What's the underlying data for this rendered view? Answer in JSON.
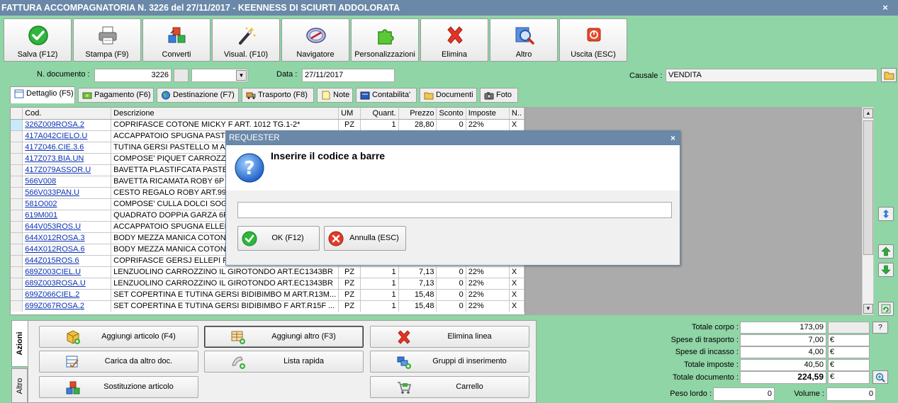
{
  "window": {
    "title": "FATTURA ACCOMPAGNATORIA N. 3226 del 27/11/2017 - KEENNESS DI SCIURTI ADDOLORATA",
    "close": "×"
  },
  "toolbar": [
    {
      "label": "Salva (F12)",
      "icon": "check-icon"
    },
    {
      "label": "Stampa (F9)",
      "icon": "printer-icon"
    },
    {
      "label": "Converti",
      "icon": "convert-icon"
    },
    {
      "label": "Visual. (F10)",
      "icon": "magic-wand-icon"
    },
    {
      "label": "Navigatore",
      "icon": "compass-icon"
    },
    {
      "label": "Personalizzazioni",
      "icon": "puzzle-icon"
    },
    {
      "label": "Elimina",
      "icon": "delete-x-icon"
    },
    {
      "label": "Altro",
      "icon": "magnifier-icon"
    },
    {
      "label": "Uscita (ESC)",
      "icon": "power-icon"
    }
  ],
  "header": {
    "doc_label": "N. documento :",
    "doc_value": "3226",
    "data_label": "Data :",
    "data_value": "27/11/2017",
    "causale_label": "Causale :",
    "causale_value": "VENDITA"
  },
  "tabs": [
    {
      "label": "Dettaglio (F5)"
    },
    {
      "label": "Pagamento (F6)"
    },
    {
      "label": "Destinazione (F7)"
    },
    {
      "label": "Trasporto (F8)"
    },
    {
      "label": "Note"
    },
    {
      "label": "Contabilita'"
    },
    {
      "label": "Documenti"
    },
    {
      "label": "Foto"
    }
  ],
  "grid": {
    "columns": [
      "Cod.",
      "Descrizione",
      "UM",
      "Quant.",
      "Prezzo",
      "Sconto",
      "Imposte",
      "N.."
    ],
    "rows": [
      {
        "cod": "326Z009ROSA.2",
        "desc": "COPRIFASCE  COTONE MICKY F  ART. 1012  TG.1-2*",
        "um": "PZ",
        "quant": "1",
        "prezzo": "28,80",
        "sconto": "0",
        "imposte": "22%",
        "n": "X"
      },
      {
        "cod": "417A042CIELO.U",
        "desc": "ACCAPPATOIO SPUGNA PASTE",
        "um": "",
        "quant": "",
        "prezzo": "",
        "sconto": "",
        "imposte": "",
        "n": ""
      },
      {
        "cod": "417Z046.CIE.3.6",
        "desc": "TUTINA GERSI PASTELLO M AR",
        "um": "",
        "quant": "",
        "prezzo": "",
        "sconto": "",
        "imposte": "",
        "n": ""
      },
      {
        "cod": "417Z073.BIA.UN",
        "desc": "COMPOSE' PIQUET CARROZZIN",
        "um": "",
        "quant": "",
        "prezzo": "",
        "sconto": "",
        "imposte": "",
        "n": ""
      },
      {
        "cod": "417Z079ASSOR.U",
        "desc": "BAVETTA PLASTIFCATA PASTE",
        "um": "",
        "quant": "",
        "prezzo": "",
        "sconto": "",
        "imposte": "",
        "n": ""
      },
      {
        "cod": "566V008",
        "desc": "BAVETTA RICAMATA ROBY  6P",
        "um": "",
        "quant": "",
        "prezzo": "",
        "sconto": "",
        "imposte": "",
        "n": ""
      },
      {
        "cod": "566V033PAN.U",
        "desc": "CESTO REGALO ROBY ART.993",
        "um": "",
        "quant": "",
        "prezzo": "",
        "sconto": "",
        "imposte": "",
        "n": ""
      },
      {
        "cod": "581O002",
        "desc": "COMPOSE' CULLA DOLCI SOGN",
        "um": "",
        "quant": "",
        "prezzo": "",
        "sconto": "",
        "imposte": "",
        "n": ""
      },
      {
        "cod": "619M001",
        "desc": "QUADRATO DOPPIA GARZA 6P",
        "um": "",
        "quant": "",
        "prezzo": "",
        "sconto": "",
        "imposte": "",
        "n": ""
      },
      {
        "cod": "644V053ROS.U",
        "desc": "ACCAPPATOIO SPUGNA ELLEPI",
        "um": "",
        "quant": "",
        "prezzo": "",
        "sconto": "",
        "imposte": "",
        "n": ""
      },
      {
        "cod": "644X012ROSA.3",
        "desc": "BODY MEZZA MANICA  COTON",
        "um": "",
        "quant": "",
        "prezzo": "",
        "sconto": "",
        "imposte": "",
        "n": ""
      },
      {
        "cod": "644X012ROSA.6",
        "desc": "BODY MEZZA MANICA  COTON",
        "um": "",
        "quant": "",
        "prezzo": "",
        "sconto": "",
        "imposte": "",
        "n": ""
      },
      {
        "cod": "644Z015ROS.6",
        "desc": "COPRIFASCE GERSJ  ELLEPI F",
        "um": "",
        "quant": "",
        "prezzo": "",
        "sconto": "",
        "imposte": "",
        "n": ""
      },
      {
        "cod": "689Z003CIEL.U",
        "desc": "LENZUOLINO CARROZZINO IL GIROTONDO ART.EC1343BR",
        "um": "PZ",
        "quant": "1",
        "prezzo": "7,13",
        "sconto": "0",
        "imposte": "22%",
        "n": "X"
      },
      {
        "cod": "689Z003ROSA.U",
        "desc": "LENZUOLINO CARROZZINO IL GIROTONDO ART.EC1343BR",
        "um": "PZ",
        "quant": "1",
        "prezzo": "7,13",
        "sconto": "0",
        "imposte": "22%",
        "n": "X"
      },
      {
        "cod": "699Z066CIEL.2",
        "desc": "SET COPERTINA E TUTINA GERSI BIDIBIMBO M ART.R13M...",
        "um": "PZ",
        "quant": "1",
        "prezzo": "15,48",
        "sconto": "0",
        "imposte": "22%",
        "n": "X"
      },
      {
        "cod": "699Z067ROSA.2",
        "desc": "SET COPERTINA E TUTINA GERSI BIDIBIMBO F ART.R15F ...",
        "um": "PZ",
        "quant": "1",
        "prezzo": "15,48",
        "sconto": "0",
        "imposte": "22%",
        "n": "X"
      }
    ]
  },
  "side_tabs": {
    "azioni": "Azioni",
    "altro": "Altro"
  },
  "actions": [
    {
      "label": "Aggiungi articolo (F4)",
      "icon": "box-add-icon"
    },
    {
      "label": "Aggiungi altro (F3)",
      "icon": "grid-add-icon"
    },
    {
      "label": "Elimina linea",
      "icon": "delete-x-icon"
    },
    {
      "label": "Carica da altro doc.",
      "icon": "load-doc-icon"
    },
    {
      "label": "Lista rapida",
      "icon": "quick-list-icon"
    },
    {
      "label": "Gruppi di inserimento",
      "icon": "group-insert-icon"
    },
    {
      "label": "Sostituzione articolo",
      "icon": "replace-icon"
    },
    {
      "label": "Carrello",
      "icon": "cart-icon"
    }
  ],
  "totals": {
    "corpo_label": "Totale corpo :",
    "corpo": "173,09",
    "trasporto_label": "Spese di trasporto :",
    "trasporto": "7,00",
    "incasso_label": "Spese di incasso :",
    "incasso": "4,00",
    "imposte_label": "Totale imposte :",
    "imposte": "40,50",
    "documento_label": "Totale documento :",
    "documento": "224,59",
    "currency": "€",
    "peso_label": "Peso lordo :",
    "peso": "0",
    "volume_label": "Volume :",
    "volume": "0",
    "help": "?"
  },
  "dialog": {
    "title": "REQUESTER",
    "close": "×",
    "message": "Inserire il codice a barre",
    "input_value": "",
    "ok_label": "OK (F12)",
    "cancel_label": "Annulla (ESC)"
  }
}
